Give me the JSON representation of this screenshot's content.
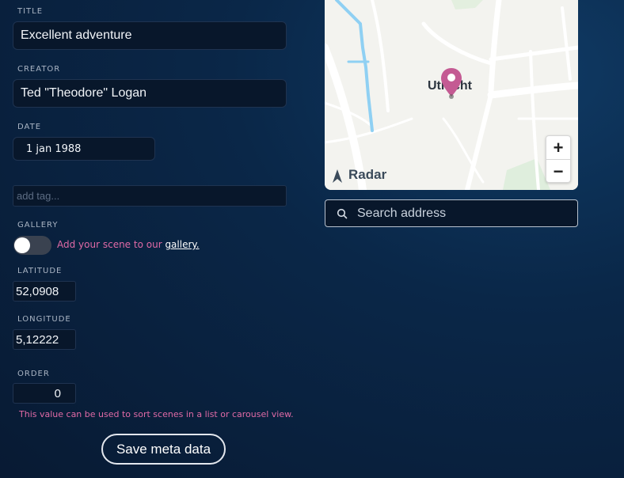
{
  "form": {
    "title_label": "TITLE",
    "title_value": "Excellent adventure",
    "creator_label": "CREATOR",
    "creator_value": "Ted \"Theodore\" Logan",
    "date_label": "DATE",
    "date_value": "1 jan 1988",
    "tag_placeholder": "add tag...",
    "gallery_label": "GALLERY",
    "gallery_text": "Add your scene to our ",
    "gallery_link": "gallery.",
    "gallery_enabled": false,
    "latitude_label": "LATITUDE",
    "latitude_value": "52,0908",
    "longitude_label": "LONGITUDE",
    "longitude_value": "5,12222",
    "order_label": "ORDER",
    "order_value": "0",
    "order_hint": "This value can be used to sort scenes in a list or carousel view.",
    "save_label": "Save meta data"
  },
  "map": {
    "city_label": "Utrecht",
    "brand": "Radar",
    "zoom_in": "+",
    "zoom_out": "−",
    "pin_color": "#c45a93"
  },
  "search": {
    "placeholder": "Search address"
  },
  "colors": {
    "accent_pink": "#e06aa6",
    "background": "#0a2748",
    "field_bg": "#08172b"
  }
}
